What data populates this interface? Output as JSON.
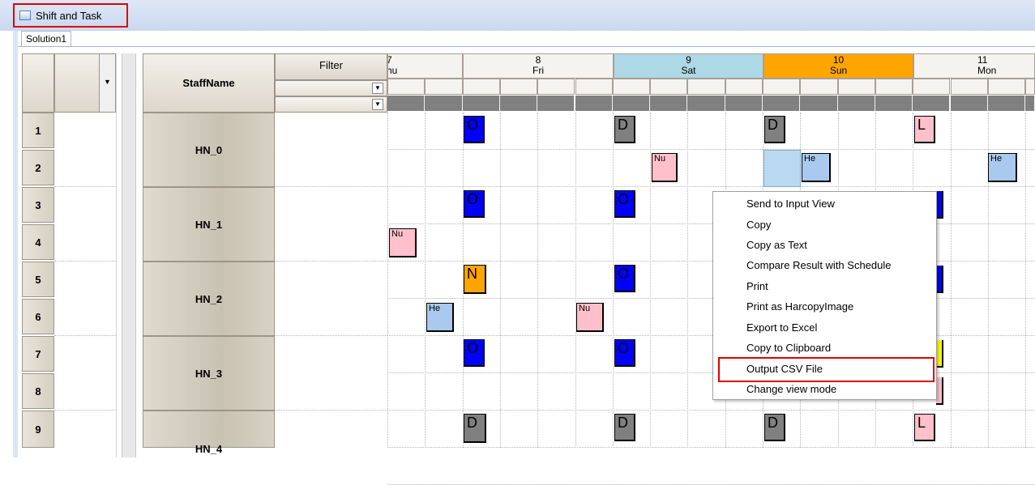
{
  "window": {
    "title": "Shift and Task"
  },
  "tabs": [
    {
      "label": "Solution1"
    }
  ],
  "grid": {
    "staff_header": "StaffName",
    "filter_header": "Filter",
    "row_numbers": [
      "1",
      "2",
      "3",
      "4",
      "5",
      "6",
      "7",
      "8",
      "9"
    ],
    "staff_names": [
      "HN_0",
      "HN_1",
      "HN_2",
      "HN_3",
      "HN_4"
    ],
    "days": [
      {
        "num": "7",
        "name": "hu",
        "color": "#f5f3ef"
      },
      {
        "num": "8",
        "name": "Fri",
        "color": "#f5f3ef"
      },
      {
        "num": "9",
        "name": "Sat",
        "color": "#add8e6"
      },
      {
        "num": "10",
        "name": "Sun",
        "color": "#ffa500"
      },
      {
        "num": "11",
        "name": "Mon",
        "color": "#f5f3ef"
      }
    ]
  },
  "shift_tiles": [
    {
      "text": "O",
      "color": "#0000ff"
    },
    {
      "text": "D",
      "color": "#808080"
    },
    {
      "text": "D",
      "color": "#808080"
    },
    {
      "text": "L",
      "color": "#ffc0cb"
    },
    {
      "text": "Nu",
      "color": "#ffc0cb"
    },
    {
      "text": "",
      "color": "#b9d9f1"
    },
    {
      "text": "He",
      "color": "#a9c9ee"
    },
    {
      "text": "He",
      "color": "#a9c9ee"
    },
    {
      "text": "O",
      "color": "#0000ff"
    },
    {
      "text": "O",
      "color": "#0000ff"
    },
    {
      "text": "Nu",
      "color": "#ffc0cb"
    },
    {
      "text": "N",
      "color": "#ffa500"
    },
    {
      "text": "O",
      "color": "#0000ff"
    },
    {
      "text": "He",
      "color": "#a9c9ee"
    },
    {
      "text": "Nu",
      "color": "#ffc0cb"
    },
    {
      "text": "O",
      "color": "#0000ff"
    },
    {
      "text": "O",
      "color": "#0000ff"
    },
    {
      "text": "D",
      "color": "#808080"
    },
    {
      "text": "D",
      "color": "#808080"
    },
    {
      "text": "D",
      "color": "#808080"
    },
    {
      "text": "L",
      "color": "#ffc0cb"
    }
  ],
  "context_menu": {
    "items": [
      "Send to Input View",
      "Copy",
      "Copy as Text",
      "Compare Result with Schedule",
      "Print",
      "Print as HarcopyImage",
      "Export to Excel",
      "Copy to Clipboard",
      "Output CSV File",
      "Change view mode"
    ],
    "highlighted": "Output CSV File"
  }
}
